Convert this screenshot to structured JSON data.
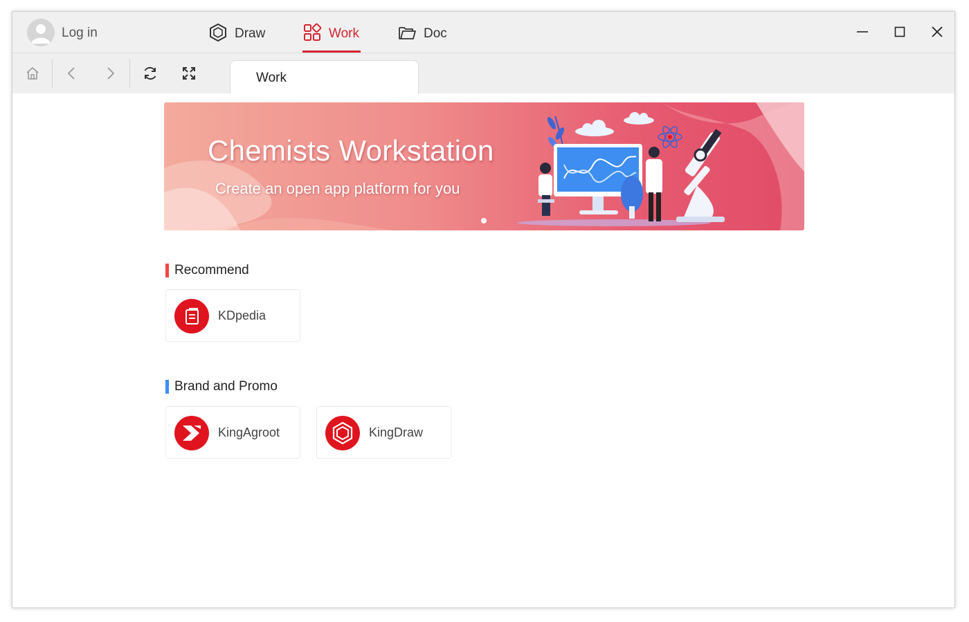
{
  "titlebar": {
    "login_label": "Log in",
    "tabs": [
      {
        "label": "Draw",
        "icon": "hexagon-icon",
        "active": false
      },
      {
        "label": "Work",
        "icon": "grid-apps-icon",
        "active": true
      },
      {
        "label": "Doc",
        "icon": "folder-icon",
        "active": false
      }
    ],
    "window_controls": [
      "minimize-icon",
      "maximize-icon",
      "close-icon"
    ]
  },
  "toolbar": {
    "buttons": [
      "home-icon",
      "back-icon",
      "forward-icon",
      "refresh-icon",
      "fullscreen-icon"
    ],
    "open_tab": "Work"
  },
  "banner": {
    "title": "Chemists Workstation",
    "subtitle": "Create an open app platform for you",
    "slide_count": 1,
    "active_slide": 1
  },
  "sections": [
    {
      "title": "Recommend",
      "accent": "#f04747",
      "apps": [
        {
          "name": "KDpedia",
          "icon": "book-icon"
        }
      ]
    },
    {
      "title": "Brand and Promo",
      "accent": "#3d8ef0",
      "apps": [
        {
          "name": "KingAgroot",
          "icon": "chevron-logo-icon"
        },
        {
          "name": "KingDraw",
          "icon": "hexagon-logo-icon"
        }
      ]
    }
  ],
  "colors": {
    "accent": "#d5252f",
    "app_logo": "#e0141e"
  }
}
